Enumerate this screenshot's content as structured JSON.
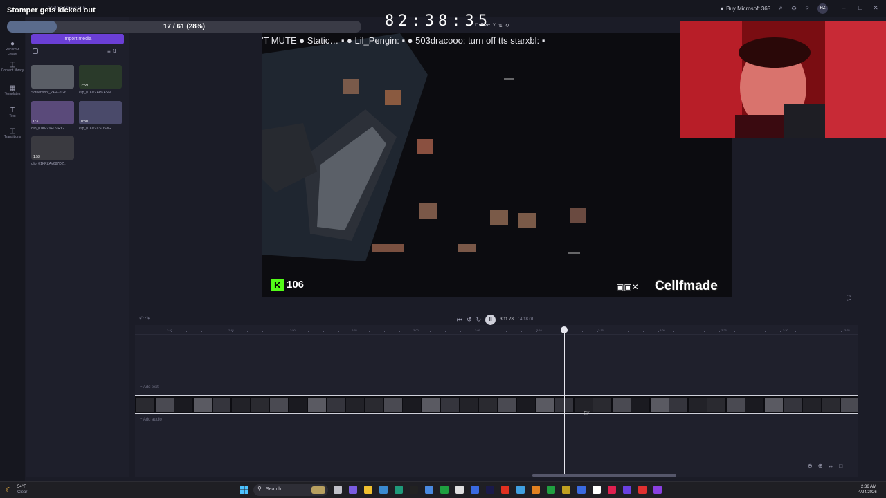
{
  "overlay": {
    "stream_title": "Stomper gets kicked out",
    "countdown": "82:38:35",
    "progress_text": "17 / 61 (28%)",
    "progress_fraction": 0.28
  },
  "app": {
    "project_name": "Video Project 6",
    "buy_microsoft": "Buy Microsoft 365",
    "user_initials": "HZ"
  },
  "rail": {
    "items": [
      {
        "label": "Record & create",
        "icon": "camera-icon"
      },
      {
        "label": "Content library",
        "icon": "library-icon"
      },
      {
        "label": "Templates",
        "icon": "templates-icon"
      },
      {
        "label": "Text",
        "icon": "text-icon"
      },
      {
        "label": "Transitions",
        "icon": "transitions-icon"
      }
    ]
  },
  "media": {
    "import_label": "Import media",
    "items": [
      {
        "label": "Screenshot_24-4-2026...",
        "duration": ""
      },
      {
        "label": "clip_01KPZAPKESN...",
        "duration": "2:59"
      },
      {
        "label": "clip_01KPZ9FUVRY2...",
        "duration": "0:31"
      },
      {
        "label": "clip_01KPZCSDS8G...",
        "duration": "0:30"
      },
      {
        "label": "clip_01KPZAV687DZ...",
        "duration": "1:53"
      }
    ]
  },
  "preview": {
    "chat_line": "'T MUTE ● Static… ▪ ● Lil_Pengin: ▪ ● 503dracooo: turn off tts starxbl: ▪",
    "kick_count": "106",
    "watermark": "Cellfmade",
    "size_label": "Size"
  },
  "playback": {
    "time_current": "3:11.78",
    "time_total": "/ 4:18.01"
  },
  "timeline": {
    "tick_labels": [
      "2:40",
      "2:45",
      "2:50",
      "2:55",
      "3:00",
      "3:05",
      "3:10",
      "3:15",
      "3:20",
      "3:25",
      "3:30",
      "3:35"
    ],
    "add_text": "+ Add text",
    "add_audio": "+ Add audio",
    "playhead_fraction": 0.743
  },
  "taskbar": {
    "weather_temp": "54°F",
    "weather_desc": "Clear",
    "search_placeholder": "Search",
    "clock_time": "2:36 AM",
    "clock_date": "4/24/2026"
  }
}
